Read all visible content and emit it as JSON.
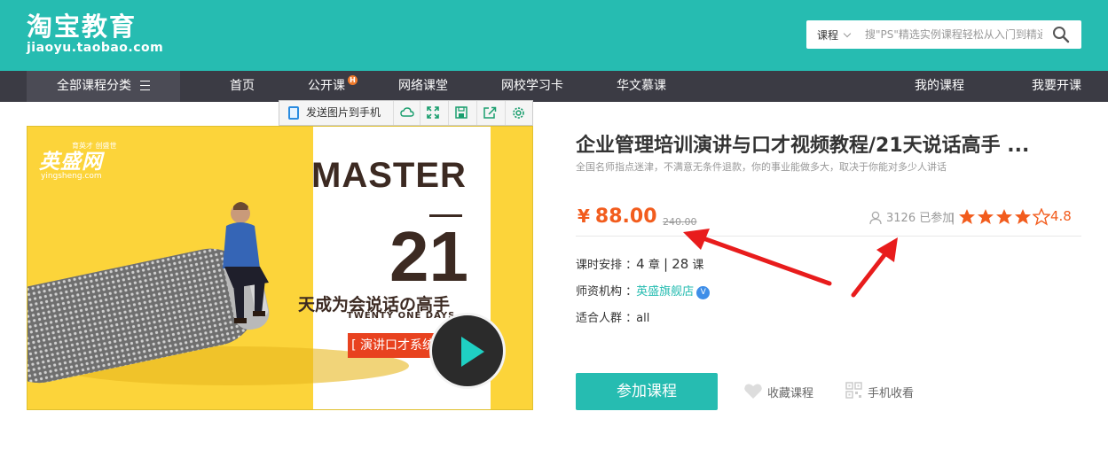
{
  "header": {
    "logo_title": "淘宝教育",
    "logo_domain": "jiaoyu.taobao.com",
    "search_type": "课程",
    "search_placeholder": "搜\"PS\"精选实例课程轻松从入门到精通",
    "brand_color": "#26bcb1"
  },
  "nav": {
    "all_categories": "全部课程分类",
    "items": [
      "首页",
      "公开课",
      "网络课堂",
      "网校学习卡",
      "华文慕课"
    ],
    "hot_badge": "H",
    "right_items": [
      "我的课程",
      "我要开课"
    ]
  },
  "image_toolbar": {
    "send_label": "发送图片到手机",
    "tools": [
      "cloud-icon",
      "expand-icon",
      "save-icon",
      "share-icon",
      "settings-icon"
    ]
  },
  "banner": {
    "brand_cn": "英盛网",
    "brand_tagline": "育英才 创盛世",
    "brand_url": "yingsheng.com",
    "headline": "MASTER",
    "number": "21",
    "slogan": "天成为会说话の高手",
    "subline": "TWENTY ONE DAYS",
    "tag": "[ 演讲口才系统班 ]"
  },
  "course": {
    "title": "企业管理培训演讲与口才视频教程/21天说话高手 ...",
    "subtitle": "全国名师指点迷津，不满意无条件退款，你的事业能做多大，取决于你能对多少人讲话",
    "price_symbol": "¥",
    "price": "88.00",
    "original_price": "240.00",
    "learners": "3126 已参加",
    "separator": "|",
    "rating_stars": 4,
    "rating": "4.8",
    "schedule_label": "课时安排 ：",
    "chapters": "4",
    "chapters_unit": "章",
    "pipe": "|",
    "lessons": "28",
    "lessons_unit": "课",
    "teacher_label": "师资机构 ：",
    "teacher": "英盛旗舰店",
    "audience_label": "适合人群 ：",
    "audience": "all",
    "join_button": "参加课程",
    "favorite": "收藏课程",
    "mobile_favorite": "手机收看"
  }
}
